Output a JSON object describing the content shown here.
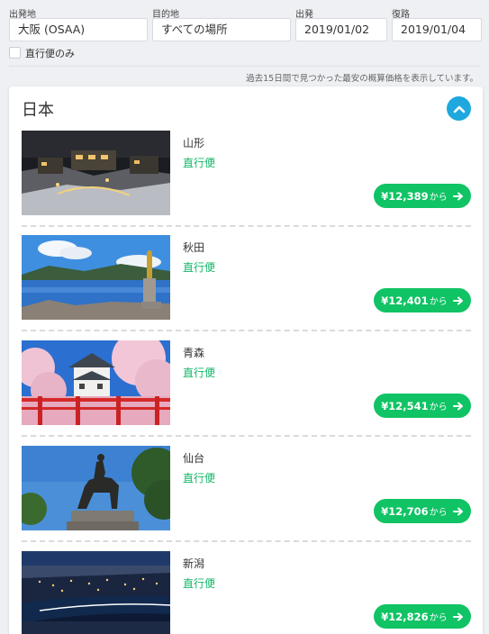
{
  "search": {
    "origin_label": "出発地",
    "origin_value": "大阪 (OSAA)",
    "destination_label": "目的地",
    "destination_value": "すべての場所",
    "depart_label": "出発",
    "depart_value": "2019/01/02",
    "return_label": "復路",
    "return_value": "2019/01/04",
    "direct_only_label": "直行便のみ",
    "direct_only_checked": false
  },
  "notice": "過去15日間で見つかった最安の概算価格を表示しています。",
  "region": {
    "title": "日本",
    "collapse_icon": "chevron-up-icon",
    "accent_color": "#1ea8dd",
    "destinations": [
      {
        "city": "山形",
        "direct": "直行便",
        "price": "¥12,389",
        "suffix": "から",
        "image": "snowy-hot-spring-town-night"
      },
      {
        "city": "秋田",
        "direct": "直行便",
        "price": "¥12,401",
        "suffix": "から",
        "image": "lake-statue-blue-sky"
      },
      {
        "city": "青森",
        "direct": "直行便",
        "price": "¥12,541",
        "suffix": "から",
        "image": "castle-cherry-blossoms-red-bridge"
      },
      {
        "city": "仙台",
        "direct": "直行便",
        "price": "¥12,706",
        "suffix": "から",
        "image": "equestrian-statue"
      },
      {
        "city": "新潟",
        "direct": "直行便",
        "price": "¥12,826",
        "suffix": "から",
        "image": "city-night-river"
      }
    ],
    "price_button_color": "#10c364",
    "direct_color": "#12b76a"
  }
}
